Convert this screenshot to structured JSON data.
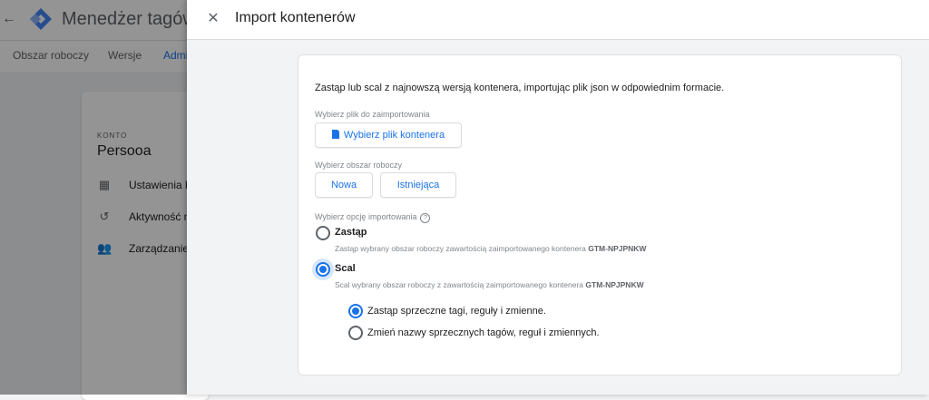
{
  "background": {
    "app_title": "Menedżer tagów",
    "tabs": [
      "Obszar roboczy",
      "Wersje",
      "Admi"
    ],
    "card": {
      "kicker": "KONTO",
      "account_name": "Persooa",
      "menu": [
        {
          "label": "Ustawienia ko",
          "icon": "building-icon"
        },
        {
          "label": "Aktywność na",
          "icon": "history-icon"
        },
        {
          "label": "Zarządzanie u",
          "icon": "people-icon"
        }
      ]
    }
  },
  "dialog": {
    "close_icon": "✕",
    "title": "Import kontenerów",
    "intro": "Zastąp lub scal z najnowszą wersją kontenera, importując plik json w odpowiednim formacie.",
    "file_label": "Wybierz plik do zaimportowania",
    "file_button": "Wybierz plik kontenera",
    "workspace_label": "Wybierz obszar roboczy",
    "workspace_new": "Nowa",
    "workspace_existing": "Istniejąca",
    "import_option_label": "Wybierz opcję importowania",
    "help_icon": "?",
    "options": [
      {
        "title": "Zastąp",
        "desc": "Zastąp wybrany obszar roboczy zawartością zaimportowanego kontenera ",
        "container": "GTM-NPJPNKW",
        "checked": false
      },
      {
        "title": "Scal",
        "desc": "Scal wybrany obszar roboczy z zawartością zaimportowanego kontenera ",
        "container": "GTM-NPJPNKW",
        "checked": true
      }
    ],
    "merge_options": [
      {
        "label": "Zastąp sprzeczne tagi, reguły i zmienne.",
        "checked": true
      },
      {
        "label": "Zmień nazwy sprzecznych tagów, reguł i zmiennych.",
        "checked": false
      }
    ]
  },
  "colors": {
    "accent": "#1a73e8",
    "scrim": "rgba(0,0,0,0.42)"
  }
}
